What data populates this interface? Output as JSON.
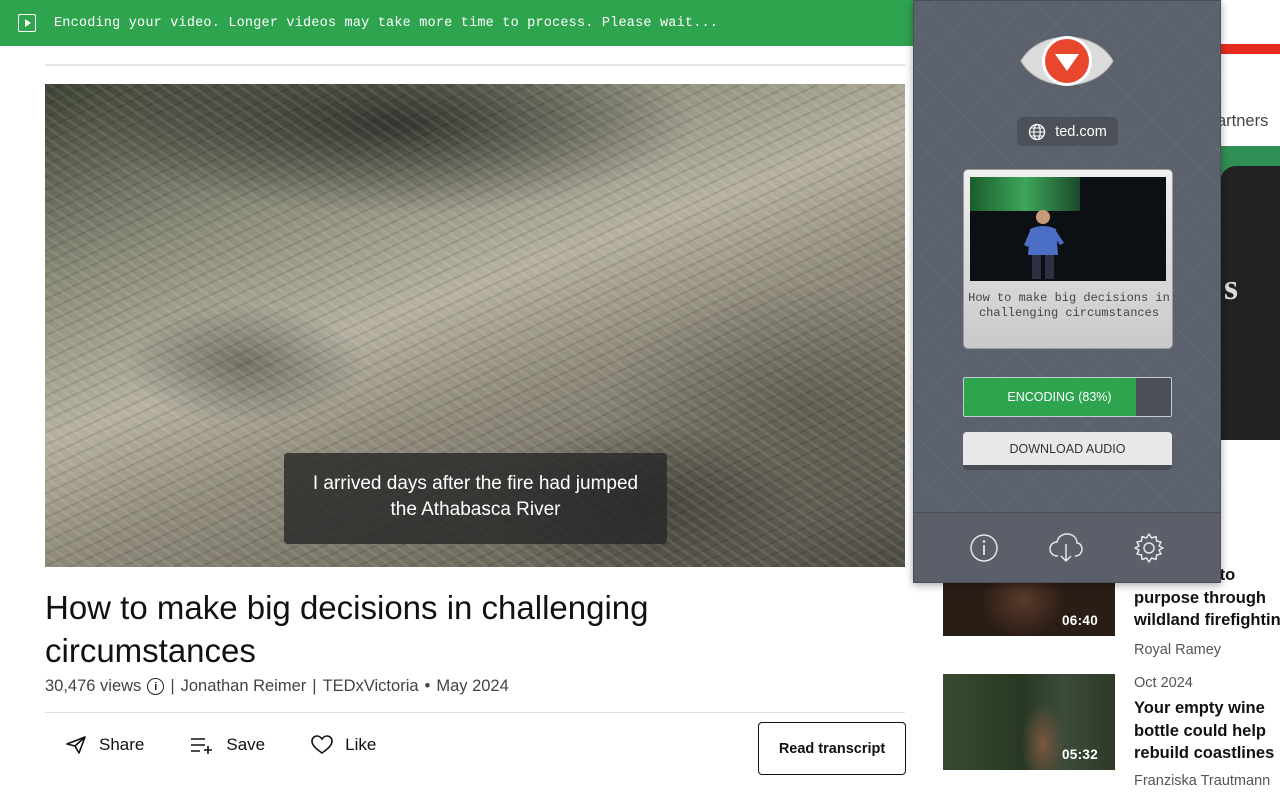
{
  "banner": {
    "message": "Encoding your video. Longer videos may take more time to process. Please wait..."
  },
  "video": {
    "caption_line1": "I arrived days after the fire had jumped",
    "caption_line2": "the Athabasca River"
  },
  "talk": {
    "title": "How to make big decisions in challenging circumstances",
    "views": "30,476 views",
    "speaker": "Jonathan Reimer",
    "event": "TEDxVictoria",
    "date": "May 2024",
    "separator": "|",
    "bullet": "•"
  },
  "actions": {
    "share": "Share",
    "save": "Save",
    "like": "Like",
    "read_transcript": "Read transcript"
  },
  "sidebar": {
    "partners_label": "artners",
    "ad_text": "s",
    "related": [
      {
        "duration": "06:40",
        "title_visible": [
          "n to",
          "purpose through",
          "wildland firefightin"
        ],
        "speaker": "Royal Ramey"
      },
      {
        "date": "Oct 2024",
        "duration": "05:32",
        "title_visible": [
          "Your empty wine",
          "bottle could help",
          "rebuild coastlines"
        ],
        "speaker": "Franziska Trautmann"
      }
    ]
  },
  "popup": {
    "site": "ted.com",
    "video_title": "How to make big decisions in challenging circumstances",
    "encoding_label": "ENCODING (83%)",
    "encoding_progress": 0.83,
    "download_audio": "DOWNLOAD AUDIO",
    "footer_icons": [
      "info-icon",
      "cloud-download-icon",
      "gear-icon"
    ]
  },
  "colors": {
    "banner_green": "#2ea44f",
    "ted_red": "#e62b1e",
    "popup_bg": "#5c626d",
    "eye_red": "#e8472e"
  }
}
